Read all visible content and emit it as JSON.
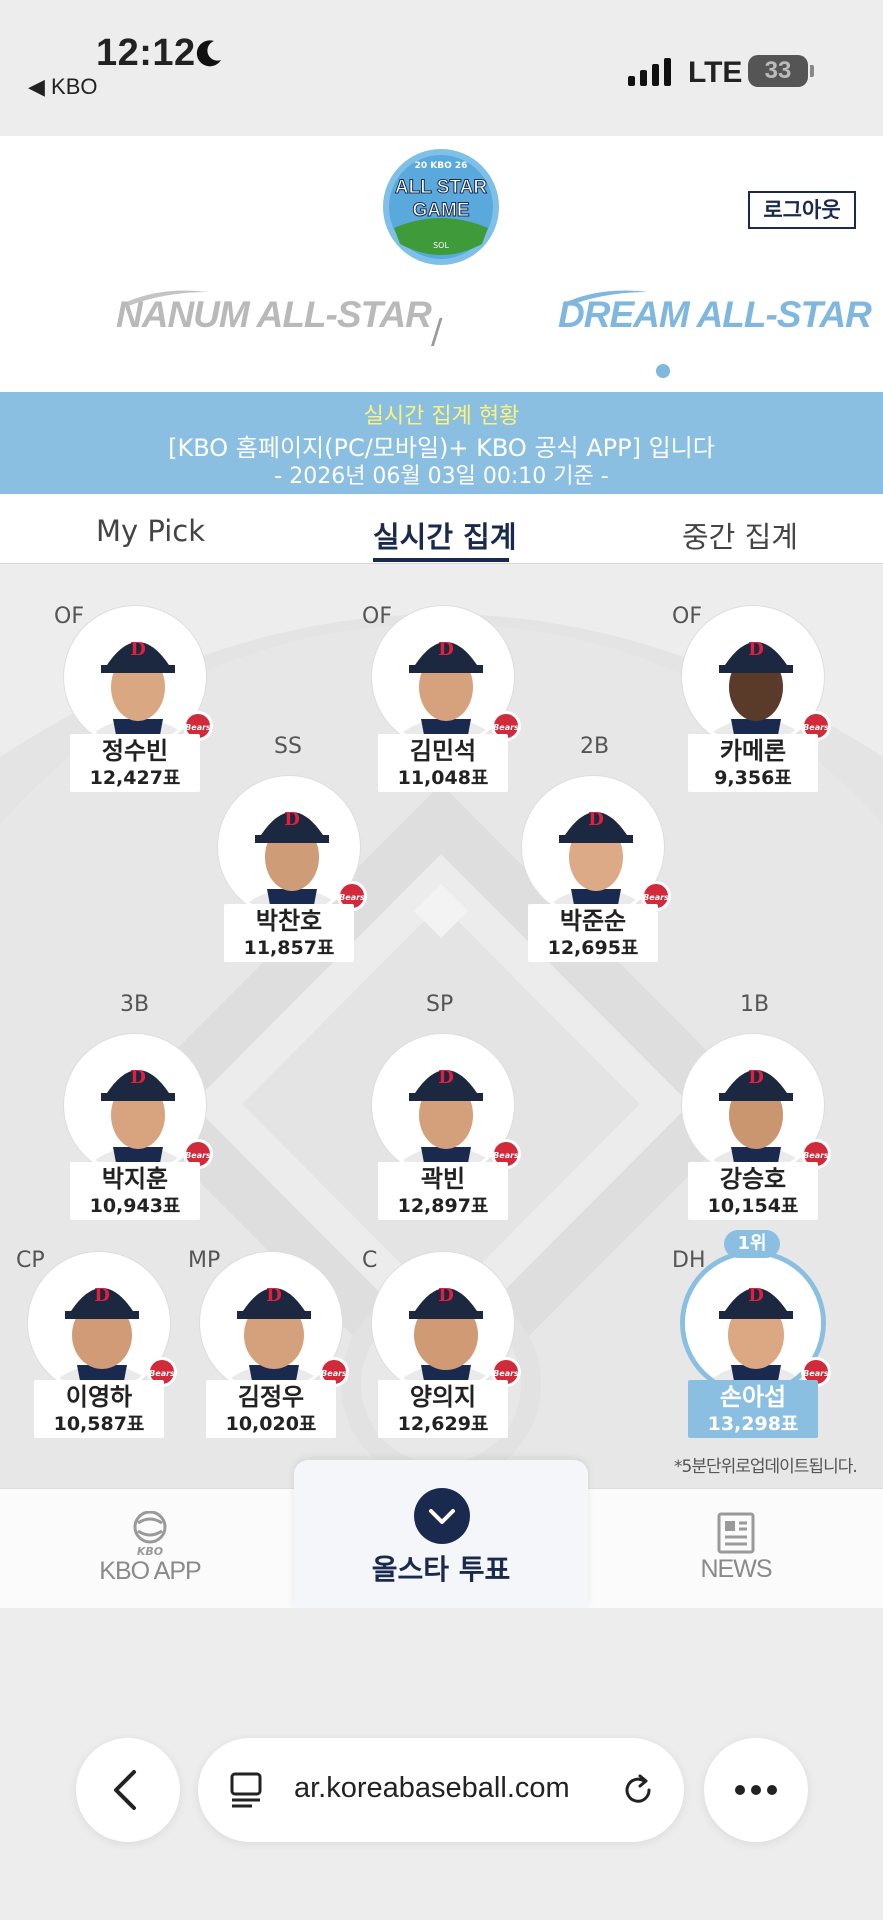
{
  "status_bar": {
    "time": "12:12",
    "back_app": "◀ KBO",
    "network": "LTE",
    "battery": "33"
  },
  "header": {
    "logo_text": "ALL STAR GAME",
    "logout_label": "로그아웃",
    "team_left": "NANUM ALL-STAR",
    "team_separator": "/",
    "team_right": "DREAM ALL-STAR"
  },
  "banner": {
    "line1": "실시간 집계 현황",
    "line2": "[KBO 홈페이지(PC/모바일)+ KBO 공식 APP] 입니다",
    "line3": "- 2026년 06월 03일 00:10 기준 -"
  },
  "tabs": [
    {
      "label": "My Pick",
      "active": false
    },
    {
      "label": "실시간 집계",
      "active": true
    },
    {
      "label": "중간 집계",
      "active": false
    }
  ],
  "players": [
    {
      "position": "OF",
      "name": "정수빈",
      "votes": "12,427표"
    },
    {
      "position": "OF",
      "name": "김민석",
      "votes": "11,048표"
    },
    {
      "position": "OF",
      "name": "카메론",
      "votes": "9,356표"
    },
    {
      "position": "SS",
      "name": "박찬호",
      "votes": "11,857표"
    },
    {
      "position": "2B",
      "name": "박준순",
      "votes": "12,695표"
    },
    {
      "position": "3B",
      "name": "박지훈",
      "votes": "10,943표"
    },
    {
      "position": "SP",
      "name": "곽빈",
      "votes": "12,897표"
    },
    {
      "position": "1B",
      "name": "강승호",
      "votes": "10,154표"
    },
    {
      "position": "CP",
      "name": "이영하",
      "votes": "10,587표"
    },
    {
      "position": "MP",
      "name": "김정우",
      "votes": "10,020표"
    },
    {
      "position": "C",
      "name": "양의지",
      "votes": "12,629표"
    },
    {
      "position": "DH",
      "name": "손아섭",
      "votes": "13,298표",
      "rank": "1위"
    }
  ],
  "update_note": "*5분단위로업데이트됩니다.",
  "bottom_nav": {
    "left_small": "KBO",
    "left_label": "KBO APP",
    "center_label": "올스타 투표",
    "right_label": "NEWS"
  },
  "browser": {
    "url": "ar.koreabaseball.com"
  },
  "colors": {
    "navy": "#1a2a4e",
    "sky": "#8bbfe2",
    "banner_yellow": "#fdf27a"
  }
}
